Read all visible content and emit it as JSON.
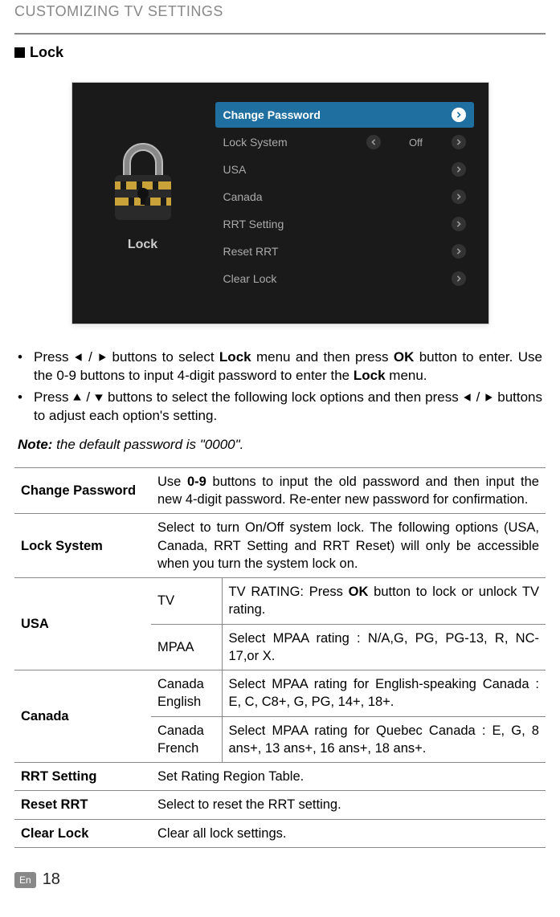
{
  "chapter": "CUSTOMIZING TV SETTINGS",
  "section_title": "Lock",
  "screenshot": {
    "side_label": "Lock",
    "items": [
      {
        "label": "Change Password",
        "type": "nav",
        "active": true
      },
      {
        "label": "Lock System",
        "type": "value",
        "value": "Off",
        "active": false
      },
      {
        "label": "USA",
        "type": "nav",
        "active": false
      },
      {
        "label": "Canada",
        "type": "nav",
        "active": false
      },
      {
        "label": "RRT Setting",
        "type": "nav",
        "active": false
      },
      {
        "label": "Reset RRT",
        "type": "nav",
        "active": false
      },
      {
        "label": "Clear Lock",
        "type": "nav",
        "active": false
      }
    ]
  },
  "bullets": {
    "b1_a": "Press ",
    "b1_b": " buttons to select ",
    "b1_bold1": "Lock",
    "b1_c": " menu and then press ",
    "b1_bold2": "OK",
    "b1_d": " button to enter. Use the 0-9 buttons to input 4-digit password to enter the ",
    "b1_bold3": "Lock",
    "b1_e": " menu.",
    "b2_a": "Press ",
    "b2_b": " buttons to select the following lock options and then press ",
    "b2_c": " buttons to adjust each option's setting."
  },
  "note_label": "Note:",
  "note_text": " the default password is \"0000\".",
  "table": {
    "change_password": {
      "k": "Change Password",
      "v_a": "Use ",
      "v_bold": "0-9",
      "v_b": " buttons to input the old password and then input the new 4-digit password. Re-enter new password for confirmation."
    },
    "lock_system": {
      "k": "Lock System",
      "v": "Select to turn On/Off system lock. The following options (USA, Canada, RRT Setting and RRT Reset) will only be accessible when you turn the system lock on."
    },
    "usa": {
      "k": "USA",
      "tv_k": "TV",
      "tv_v_a": "TV RATING: Press ",
      "tv_v_bold": "OK",
      "tv_v_b": " button to lock or unlock TV rating.",
      "mpaa_k": "MPAA",
      "mpaa_v": "Select MPAA rating : N/A,G, PG, PG-13, R, NC-17,or X."
    },
    "canada": {
      "k": "Canada",
      "en_k": "Canada English",
      "en_v": "Select MPAA rating for English-speaking Canada : E, C, C8+, G, PG, 14+, 18+.",
      "fr_k": "Canada French",
      "fr_v": "Select MPAA rating for Quebec Canada : E, G, 8 ans+, 13 ans+, 16 ans+, 18 ans+."
    },
    "rrt_setting": {
      "k": "RRT Setting",
      "v": "Set Rating Region Table."
    },
    "reset_rrt": {
      "k": "Reset RRT",
      "v": "Select to reset the RRT setting."
    },
    "clear_lock": {
      "k": "Clear Lock",
      "v": "Clear all lock settings."
    }
  },
  "footer": {
    "lang": "En",
    "page": "18"
  }
}
